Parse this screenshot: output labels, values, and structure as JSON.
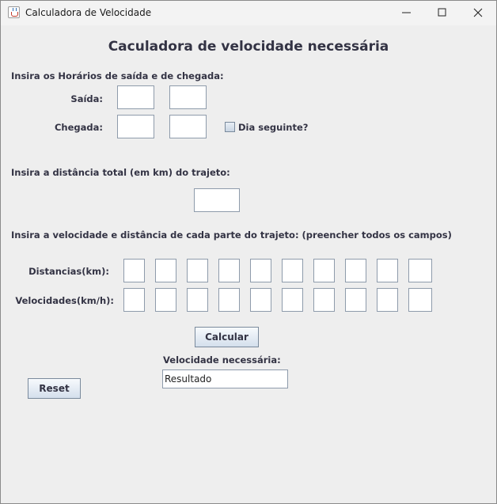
{
  "window": {
    "title": "Calculadora de Velocidade"
  },
  "form": {
    "heading": "Caculadora de velocidade necessária",
    "times_label": "Insira os Horários de saída e de chegada:",
    "departure_label": "Saída:",
    "arrival_label": "Chegada:",
    "next_day_label": "Dia seguinte?",
    "distance_label": "Insira a distância total (em km) do trajeto:",
    "segments_label": "Insira a velocidade e distância de cada parte do trajeto: (preencher todos os campos)",
    "distances_row_label": "Distancias(km):",
    "speeds_row_label": "Velocidades(km/h):",
    "calculate_label": "Calcular",
    "result_label": "Velocidade necessária:",
    "result_value": "Resultado",
    "reset_label": "Reset"
  }
}
